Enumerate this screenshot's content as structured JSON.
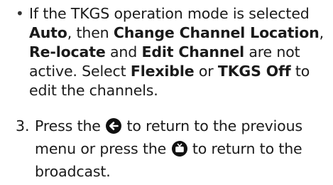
{
  "bullet": {
    "marker": "•",
    "t1": "If the TKGS operation mode is selected ",
    "b1": "Auto",
    "t2": ", then ",
    "b2": "Change Channel Location",
    "t3": ", ",
    "b3": "Re-locate",
    "t4": " and ",
    "b4": "Edit Channel",
    "t5": " are not active. Select ",
    "b5": "Flexible",
    "t6": " or ",
    "b6": "TKGS Off",
    "t7": " to edit the channels."
  },
  "step": {
    "number": "3.",
    "t1": "Press the ",
    "icon1": "back-arrow-icon",
    "t2": " to return to the previous menu or press the ",
    "icon2": "tv-icon",
    "t3": " to return to the broadcast."
  },
  "colors": {
    "text": "#1a1a1a",
    "icon": "#111111"
  }
}
